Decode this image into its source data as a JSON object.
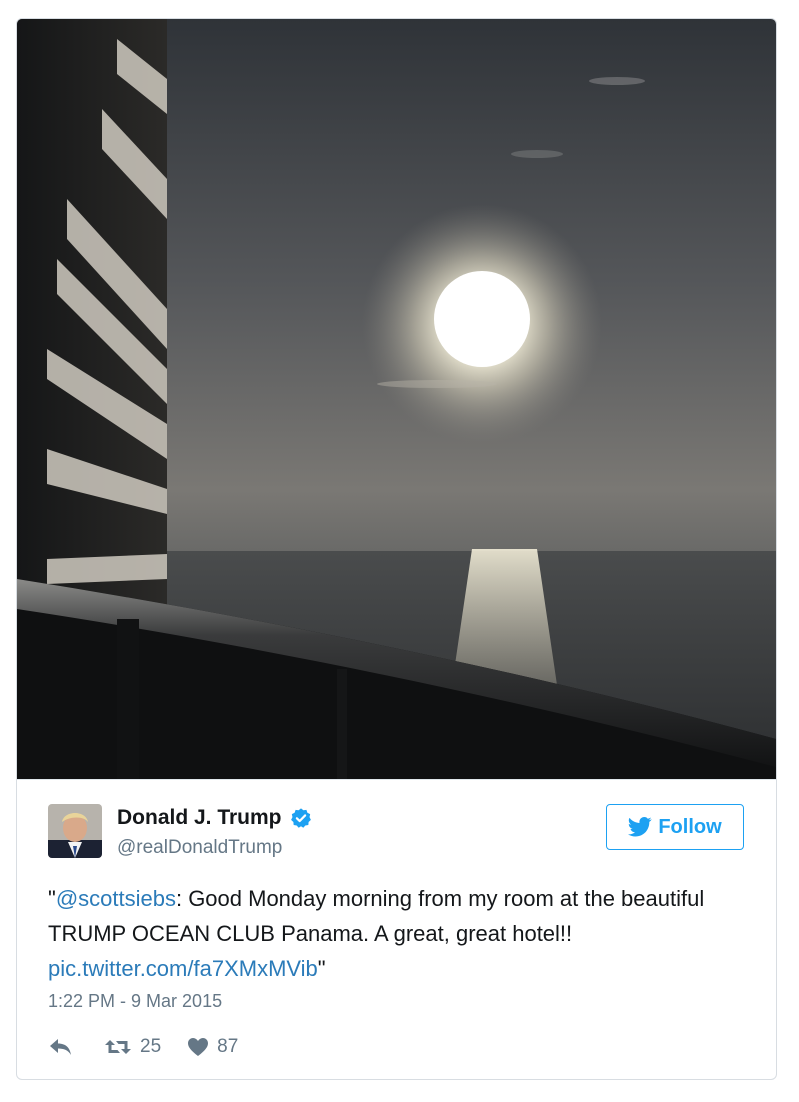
{
  "tweet": {
    "author_name": "Donald J. Trump",
    "author_handle": "@realDonaldTrump",
    "follow_label": "Follow",
    "text_open_quote": "\"",
    "mention": "@scottsiebs",
    "text_body": ": Good Monday morning from my room at the beautiful TRUMP OCEAN CLUB Panama. A great, great hotel!! ",
    "link": "pic.twitter.com/fa7XMxMVib",
    "text_close_quote": "\"",
    "timestamp": "1:22 PM - 9 Mar 2015",
    "retweet_count": "25",
    "like_count": "87"
  },
  "colors": {
    "brand": "#1da1f2",
    "link": "#2b7bb9",
    "verified": "#1da1f2",
    "text": "#14171a",
    "muted": "#657786"
  },
  "icons": {
    "verified": "verified-badge-icon",
    "follow": "twitter-bird-icon",
    "reply": "reply-icon",
    "retweet": "retweet-icon",
    "like": "heart-icon"
  }
}
